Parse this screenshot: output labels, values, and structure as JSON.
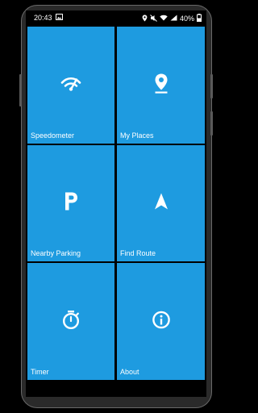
{
  "status": {
    "time": "20:43",
    "battery": "40%"
  },
  "tiles": [
    {
      "label": "Speedometer",
      "icon": "speedometer-icon"
    },
    {
      "label": "My Places",
      "icon": "location-pin-icon"
    },
    {
      "label": "Nearby Parking",
      "icon": "parking-icon"
    },
    {
      "label": "Find Route",
      "icon": "navigation-arrow-icon"
    },
    {
      "label": "Timer",
      "icon": "stopwatch-icon"
    },
    {
      "label": "About",
      "icon": "info-icon"
    }
  ],
  "colors": {
    "tile": "#1e9be0",
    "background": "#000000"
  }
}
